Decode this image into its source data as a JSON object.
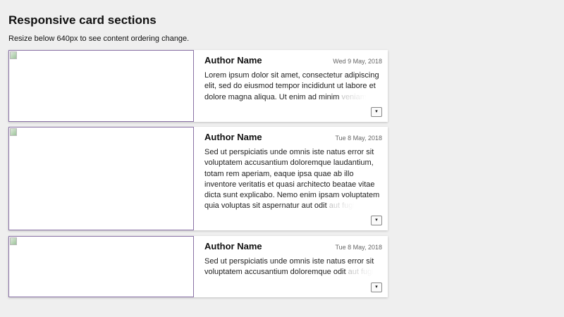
{
  "page": {
    "title": "Responsive card sections",
    "subtitle": "Resize below 640px to see content ordering change."
  },
  "cards": [
    {
      "author": "Author Name",
      "date": "Wed 9 May, 2018",
      "text": "Lorem ipsum dolor sit amet, consectetur adipiscing elit, sed do eiusmod tempor incididunt ut labore et dolore magna aliqua. Ut enim ad minim ",
      "fade": "veniam",
      "toggle": "▾"
    },
    {
      "author": "Author Name",
      "date": "Tue 8 May, 2018",
      "text": "Sed ut perspiciatis unde omnis iste natus error sit voluptatem accusantium doloremque laudantium, totam rem aperiam, eaque ipsa quae ab illo inventore veritatis et quasi architecto beatae vitae dicta sunt explicabo. Nemo enim ipsam voluptatem quia voluptas sit aspernatur aut odit ",
      "fade": "aut fugi",
      "toggle": "▾"
    },
    {
      "author": "Author Name",
      "date": "Tue 8 May, 2018",
      "text": "Sed ut perspiciatis unde omnis iste natus error sit voluptatem accusantium doloremque odit ",
      "fade": "aut fugi",
      "toggle": "▾"
    }
  ],
  "icons": {
    "broken_image": "broken-image-icon",
    "toggle": "chevron-down-icon"
  },
  "colors": {
    "image_border": "#8a72a6",
    "background": "#efefef"
  }
}
